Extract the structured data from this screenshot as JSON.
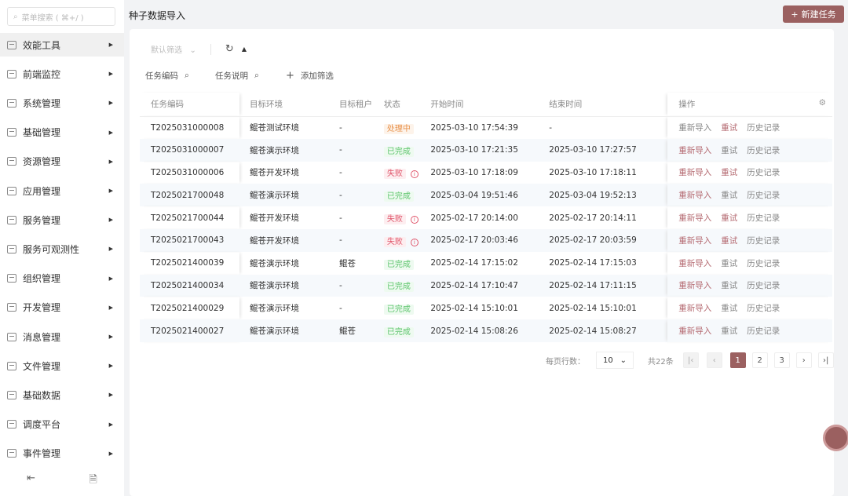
{
  "sidebar": {
    "search_placeholder": "菜单搜索 ( ⌘+/ )",
    "items": [
      "效能工具",
      "前端监控",
      "系统管理",
      "基础管理",
      "资源管理",
      "应用管理",
      "服务管理",
      "服务可观测性",
      "组织管理",
      "开发管理",
      "消息管理",
      "文件管理",
      "基础数据",
      "调度平台",
      "事件管理"
    ]
  },
  "header": {
    "title": "种子数据导入",
    "new_button": "新建任务"
  },
  "filters": {
    "default_filter": "默认筛选",
    "fields": [
      "任务编码",
      "任务说明"
    ],
    "add_filter": "添加筛选"
  },
  "table": {
    "columns": [
      "任务编码",
      "目标环境",
      "目标租户",
      "状态",
      "开始时间",
      "结束时间",
      "操作"
    ],
    "actions": [
      "重新导入",
      "重试",
      "历史记录"
    ],
    "rows": [
      [
        "T2025031000008",
        "鲲苍测试环境",
        "-",
        "处理中",
        "2025-03-10 17:54:39",
        "-"
      ],
      [
        "T2025031000007",
        "鲲苍演示环境",
        "-",
        "已完成",
        "2025-03-10 17:21:35",
        "2025-03-10 17:27:57"
      ],
      [
        "T2025031000006",
        "鲲苍开发环境",
        "-",
        "失败",
        "2025-03-10 17:18:09",
        "2025-03-10 17:18:11"
      ],
      [
        "T2025021700048",
        "鲲苍演示环境",
        "-",
        "已完成",
        "2025-03-04 19:51:46",
        "2025-03-04 19:52:13"
      ],
      [
        "T2025021700044",
        "鲲苍开发环境",
        "-",
        "失败",
        "2025-02-17 20:14:00",
        "2025-02-17 20:14:11"
      ],
      [
        "T2025021700043",
        "鲲苍开发环境",
        "-",
        "失败",
        "2025-02-17 20:03:46",
        "2025-02-17 20:03:59"
      ],
      [
        "T2025021400039",
        "鲲苍演示环境",
        "鲲苍",
        "已完成",
        "2025-02-14 17:15:02",
        "2025-02-14 17:15:03"
      ],
      [
        "T2025021400034",
        "鲲苍演示环境",
        "-",
        "已完成",
        "2025-02-14 17:10:47",
        "2025-02-14 17:11:15"
      ],
      [
        "T2025021400029",
        "鲲苍演示环境",
        "-",
        "已完成",
        "2025-02-14 15:10:01",
        "2025-02-14 15:10:01"
      ],
      [
        "T2025021400027",
        "鲲苍演示环境",
        "鲲苍",
        "已完成",
        "2025-02-14 15:08:26",
        "2025-02-14 15:08:27"
      ]
    ]
  },
  "pagination": {
    "rows_label": "每页行数：",
    "page_size": "10",
    "total": "共22条",
    "pages": [
      "1",
      "2",
      "3"
    ],
    "current": "1"
  }
}
